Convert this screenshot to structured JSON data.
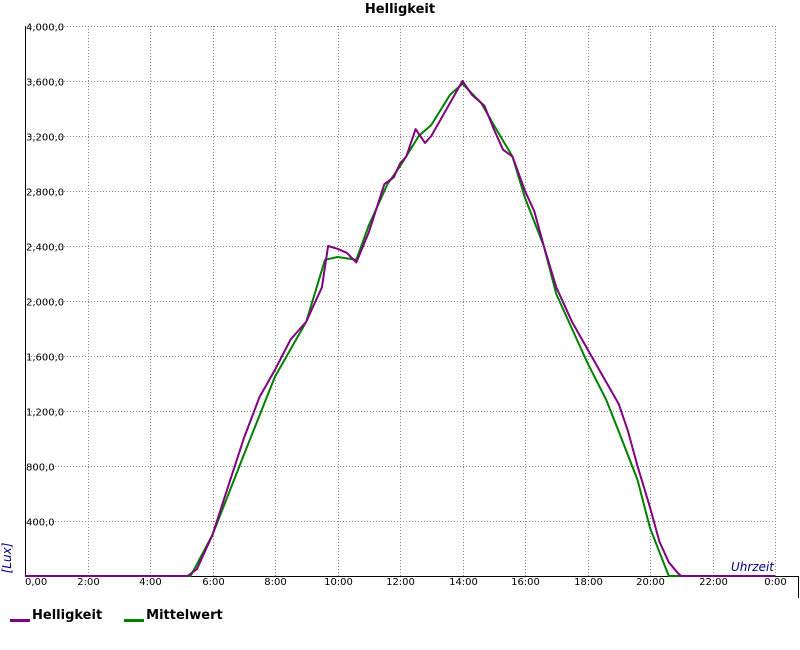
{
  "chart_data": {
    "type": "line",
    "title": "Helligkeit",
    "xlabel": "Uhrzeit",
    "ylabel": "[Lux]",
    "xlim": [
      0,
      24
    ],
    "ylim": [
      0,
      4000
    ],
    "grid": true,
    "legend_position": "bottom-left",
    "x_tick_labels": [
      "0,00",
      "2:00",
      "4:00",
      "6:00",
      "8:00",
      "10:00",
      "12:00",
      "14:00",
      "16:00",
      "18:00",
      "20:00",
      "22:00",
      "0:00"
    ],
    "y_ticks": [
      {
        "value": 400,
        "label": "400,0"
      },
      {
        "value": 800,
        "label": "800,0"
      },
      {
        "value": 1200,
        "label": "1,200,0"
      },
      {
        "value": 1600,
        "label": "1,600,0"
      },
      {
        "value": 2000,
        "label": "2,000,0"
      },
      {
        "value": 2400,
        "label": "2,400,0"
      },
      {
        "value": 2800,
        "label": "2,800,0"
      },
      {
        "value": 3200,
        "label": "3,200,0"
      },
      {
        "value": 3600,
        "label": "3,600,0"
      },
      {
        "value": 4000,
        "label": "4,000,0"
      }
    ],
    "series": [
      {
        "name": "Helligkeit",
        "color": "#800080",
        "x": [
          0,
          5.2,
          5.5,
          6.0,
          6.5,
          7.0,
          7.5,
          8.0,
          8.5,
          9.0,
          9.2,
          9.5,
          9.7,
          10.0,
          10.3,
          10.6,
          11.0,
          11.5,
          11.8,
          12.0,
          12.2,
          12.5,
          12.8,
          13.0,
          13.5,
          14.0,
          14.3,
          14.7,
          15.0,
          15.3,
          15.6,
          16.0,
          16.3,
          16.6,
          17.0,
          17.5,
          18.0,
          18.5,
          19.0,
          19.3,
          19.6,
          20.0,
          20.3,
          20.6,
          20.9,
          21.0,
          24
        ],
        "y": [
          0,
          0,
          50,
          300,
          650,
          1000,
          1300,
          1500,
          1720,
          1850,
          1950,
          2100,
          2400,
          2380,
          2350,
          2280,
          2500,
          2850,
          2900,
          3000,
          3050,
          3250,
          3150,
          3200,
          3400,
          3600,
          3500,
          3420,
          3250,
          3100,
          3050,
          2800,
          2650,
          2400,
          2100,
          1850,
          1650,
          1450,
          1250,
          1050,
          800,
          500,
          250,
          100,
          20,
          0,
          0
        ]
      },
      {
        "name": "Mittelwert",
        "color": "#008000",
        "x": [
          0,
          5.3,
          6.0,
          7.0,
          8.0,
          9.0,
          9.6,
          10.0,
          10.6,
          11.0,
          11.6,
          12.0,
          12.6,
          13.0,
          13.6,
          14.0,
          14.6,
          15.0,
          15.6,
          16.0,
          16.6,
          17.0,
          17.6,
          18.0,
          18.6,
          19.0,
          19.6,
          20.0,
          20.6,
          21.0,
          24
        ],
        "y": [
          0,
          0,
          300,
          880,
          1450,
          1850,
          2300,
          2320,
          2300,
          2550,
          2850,
          2980,
          3200,
          3280,
          3500,
          3580,
          3440,
          3280,
          3050,
          2750,
          2400,
          2050,
          1750,
          1550,
          1280,
          1050,
          700,
          350,
          0,
          0,
          0
        ]
      }
    ]
  }
}
